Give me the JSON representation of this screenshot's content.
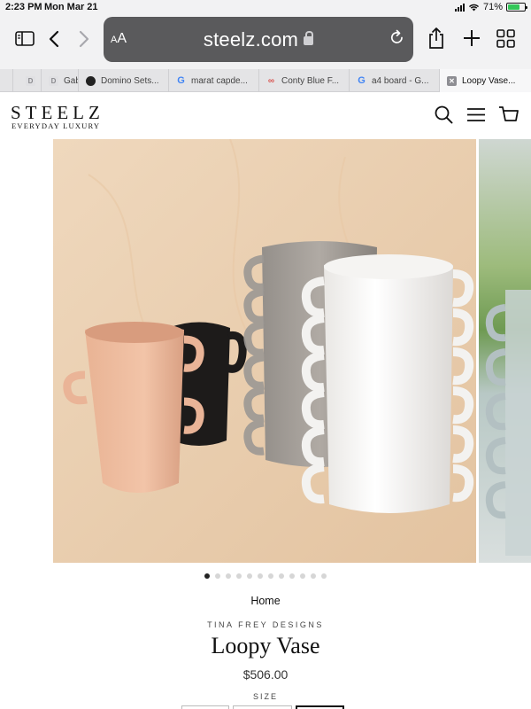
{
  "status_bar": {
    "time": "2:23 PM",
    "date": "Mon Mar 21",
    "battery": "71%",
    "battery_level": 0.71
  },
  "browser": {
    "aa_label_small": "A",
    "aa_label_large": "A",
    "domain": "steelz.com",
    "tabs": [
      {
        "title": "D",
        "favicon": "d-icon"
      },
      {
        "title": "Gab",
        "favicon": "d-icon"
      },
      {
        "title": "Domino Sets...",
        "favicon": "domino-icon"
      },
      {
        "title": "marat capde...",
        "favicon": "google-icon"
      },
      {
        "title": "Conty Blue F...",
        "favicon": "link-icon"
      },
      {
        "title": "a4 board - G...",
        "favicon": "google-icon"
      },
      {
        "title": "Loopy Vase...",
        "favicon": "close-tab-icon"
      }
    ]
  },
  "site": {
    "logo": "STEELZ",
    "tagline": "EVERYDAY LUXURY"
  },
  "product": {
    "breadcrumb": "Home",
    "vendor": "TINA FREY DESIGNS",
    "title": "Loopy Vase",
    "price": "$506.00",
    "size_label": "SIZE",
    "image_count": 12,
    "active_image": 1
  },
  "colors": {
    "accent": "#111111",
    "backdrop": "#e9cfb0"
  }
}
